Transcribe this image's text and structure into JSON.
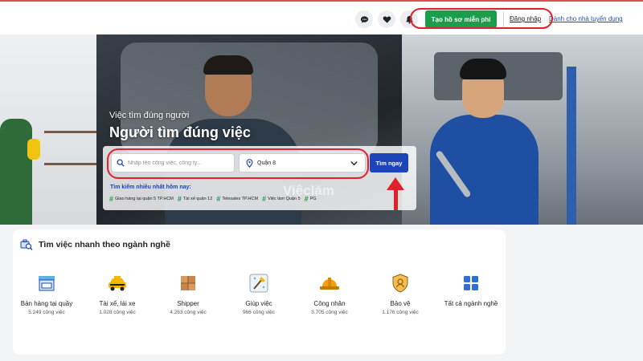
{
  "header": {
    "create_profile_label": "Tạo hồ sơ miễn phí",
    "login_label": "Đăng nhập",
    "employer_label": "Dành cho nhà tuyển dụng",
    "icons": [
      "chat-icon",
      "heart-icon",
      "bell-icon"
    ]
  },
  "hero": {
    "subtitle": "Việc tìm đúng người",
    "title": "Người tìm đúng việc",
    "watermark": "Việclàm"
  },
  "search": {
    "placeholder": "Nhập tên công việc, công ty...",
    "location_value": "Quận 8",
    "button_label": "Tìm ngay"
  },
  "popular": {
    "title": "Tìm kiếm nhiều nhất hôm nay:",
    "tags": [
      "Giao hàng tại quận 5 TP.HCM",
      "Tài xế quận 12",
      "Telesales TP.HCM",
      "Việc làm Quận 5",
      "PG"
    ]
  },
  "industries": {
    "title": "Tìm việc nhanh theo ngành nghề",
    "items": [
      {
        "name": "Bán hàng tại quầy",
        "count": "5.249 công việc"
      },
      {
        "name": "Tài xế, lái xe",
        "count": "1.028 công việc"
      },
      {
        "name": "Shipper",
        "count": "4.263 công việc"
      },
      {
        "name": "Giúp việc",
        "count": "966 công việc"
      },
      {
        "name": "Công nhân",
        "count": "3.705 công việc"
      },
      {
        "name": "Bảo vệ",
        "count": "1.176 công việc"
      },
      {
        "name": "Tất cả ngành nghề",
        "count": ""
      }
    ]
  },
  "colors": {
    "green": "#1a9e4b",
    "blue": "#1d44b8",
    "annotation_red": "#e0202a"
  }
}
